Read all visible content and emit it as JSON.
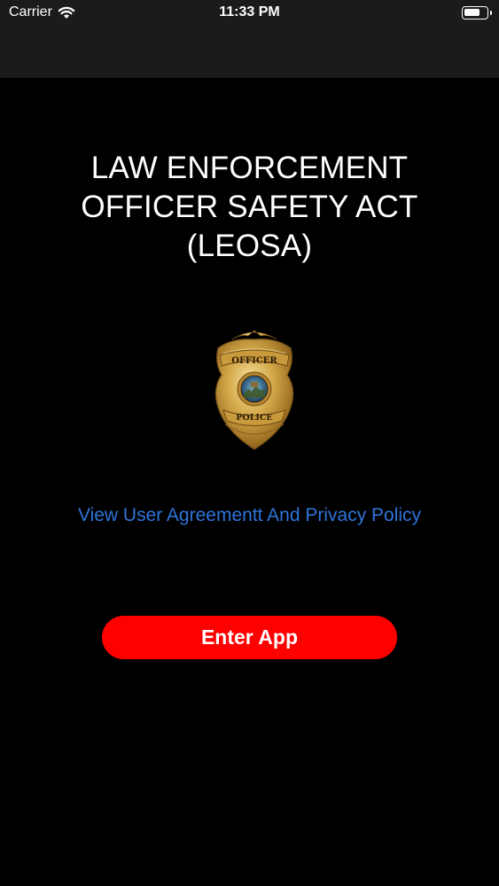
{
  "status_bar": {
    "carrier": "Carrier",
    "time": "11:33 PM",
    "battery_level": 0.75
  },
  "screen": {
    "title_lines": [
      "LAW ENFORCEMENT",
      "OFFICER SAFETY ACT",
      "(LEOSA)"
    ],
    "badge_top_text": "OFFICER",
    "badge_bottom_text": "POLICE",
    "agreement_link": "View User Agreementt And Privacy Policy",
    "enter_button": "Enter App"
  },
  "colors": {
    "background": "#000000",
    "bar": "#1b1b1b",
    "link": "#2f74d8",
    "button": "#ff0000",
    "badge_gold": "#d4a94a"
  }
}
